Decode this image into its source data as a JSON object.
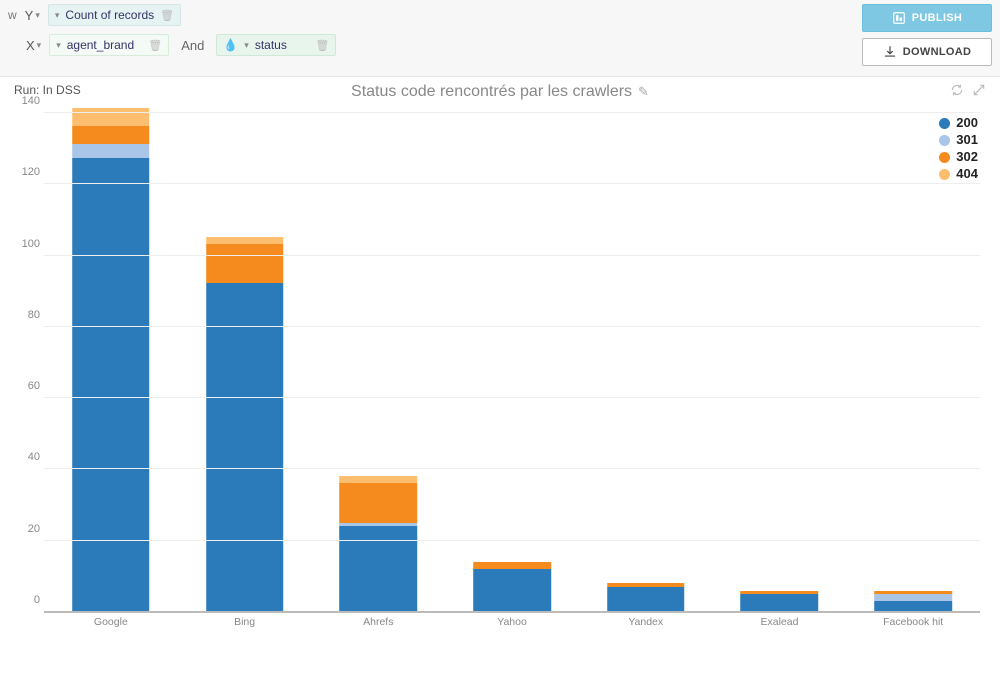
{
  "config": {
    "y_label": "Y",
    "y_pill": "Count of records",
    "x_label": "X",
    "x_pill": "agent_brand",
    "and_label": "And",
    "series_pill": "status"
  },
  "buttons": {
    "publish": "PUBLISH",
    "download": "DOWNLOAD"
  },
  "header": {
    "run_label": "Run: In DSS",
    "title": "Status code rencontrés par les crawlers"
  },
  "colors": {
    "c200": "#2b7bba",
    "c301": "#a9c5e8",
    "c302": "#f58a1f",
    "c404": "#fdbf6f"
  },
  "legend": [
    {
      "label": "200",
      "color": "#2b7bba"
    },
    {
      "label": "301",
      "color": "#a9c5e8"
    },
    {
      "label": "302",
      "color": "#f58a1f"
    },
    {
      "label": "404",
      "color": "#fdbf6f"
    }
  ],
  "chart_data": {
    "type": "bar",
    "title": "Status code rencontrés par les crawlers",
    "xlabel": "",
    "ylabel": "",
    "ylim": [
      0,
      140
    ],
    "yticks": [
      0,
      20,
      40,
      60,
      80,
      100,
      120,
      140
    ],
    "categories": [
      "Google",
      "Bing",
      "Ahrefs",
      "Yahoo",
      "Yandex",
      "Exalead",
      "Facebook hit"
    ],
    "series": [
      {
        "name": "200",
        "values": [
          127,
          92,
          24,
          12,
          7,
          5,
          3
        ]
      },
      {
        "name": "301",
        "values": [
          4,
          0,
          1,
          0,
          0,
          0,
          2
        ]
      },
      {
        "name": "302",
        "values": [
          5,
          11,
          11,
          2,
          1,
          1,
          1
        ]
      },
      {
        "name": "404",
        "values": [
          5,
          2,
          2,
          0,
          0,
          0,
          0
        ]
      }
    ]
  }
}
